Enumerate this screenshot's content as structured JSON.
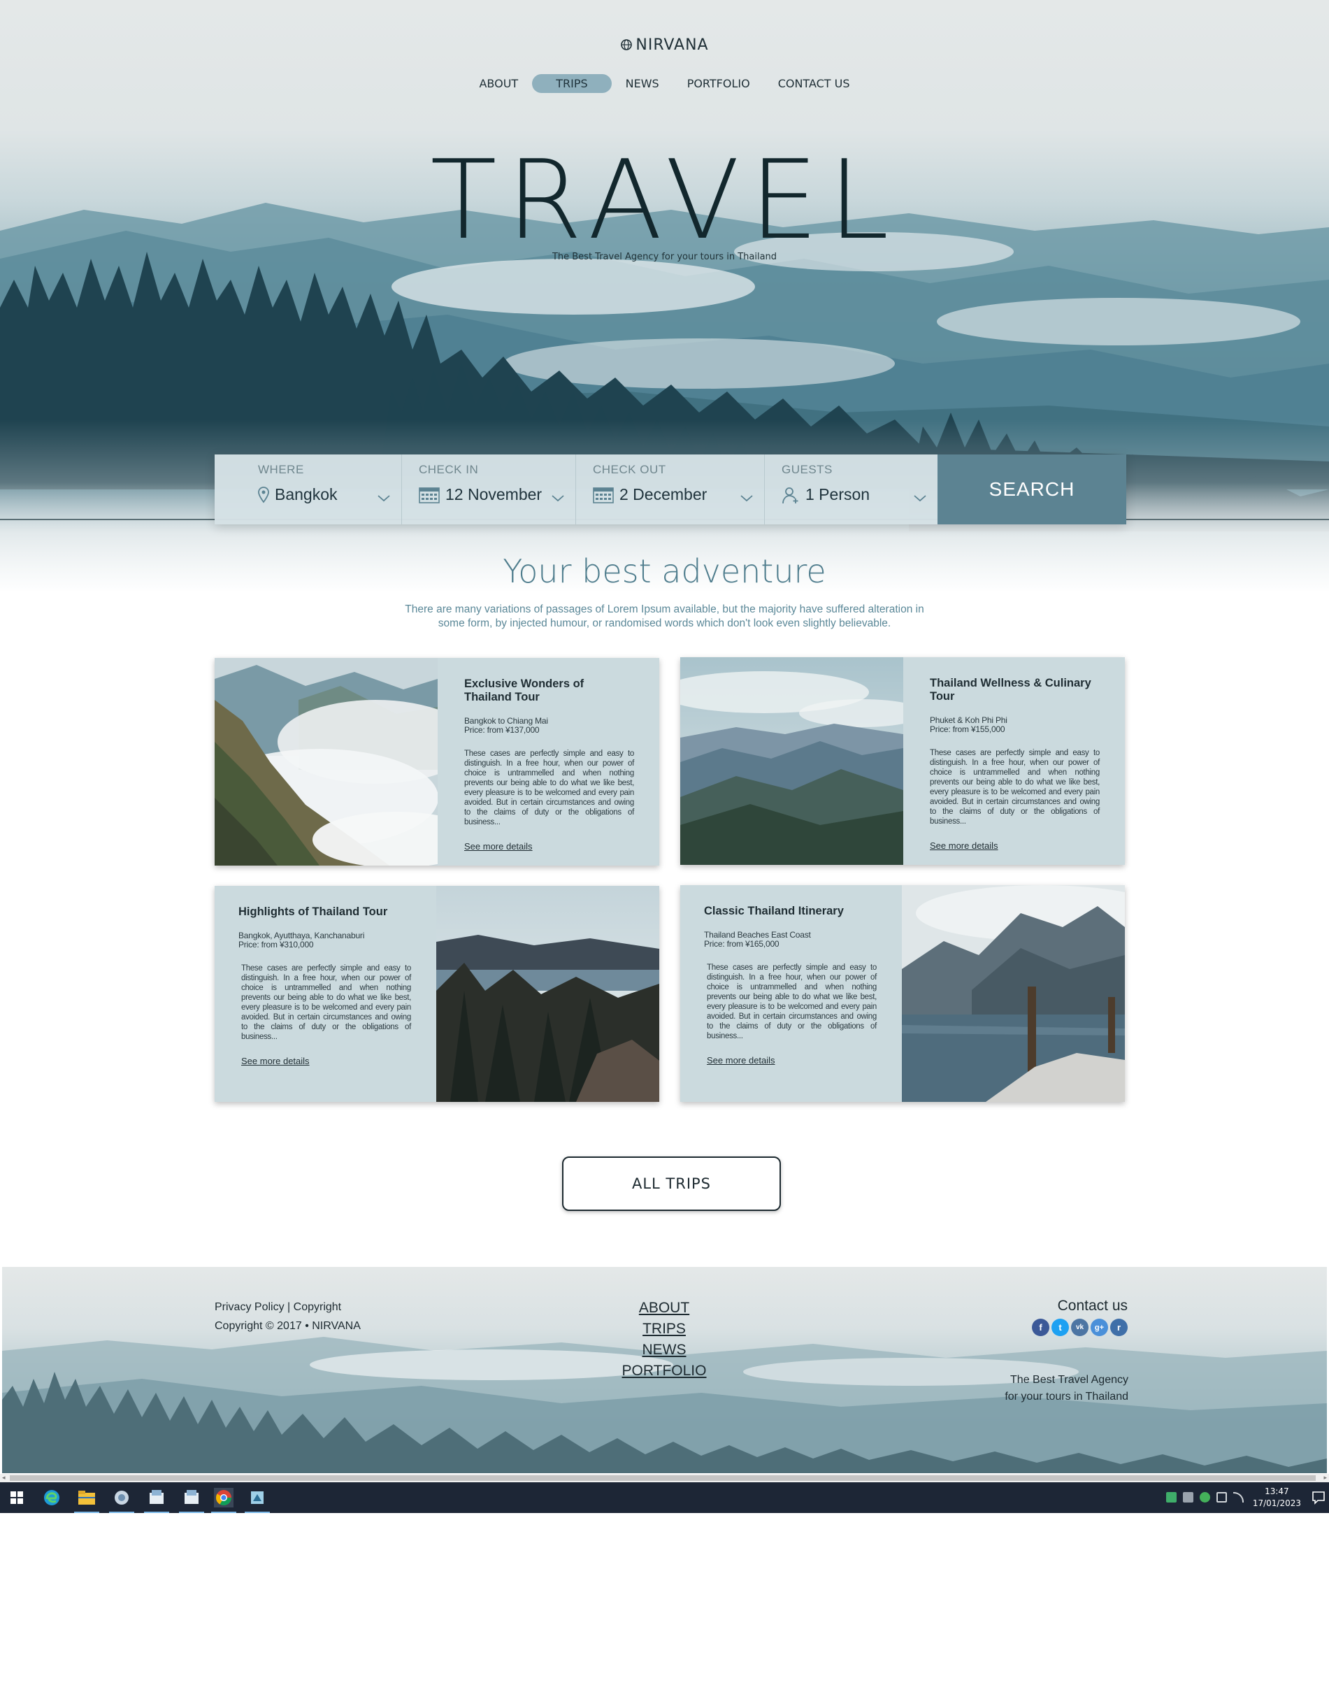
{
  "brand": {
    "name": "NIRVANA"
  },
  "nav": {
    "items": [
      "ABOUT",
      "TRIPS",
      "NEWS",
      "PORTFOLIO",
      "CONTACT US"
    ],
    "active": "TRIPS"
  },
  "hero": {
    "title": "TRAVEL",
    "subtitle": "The Best Travel Agency for your tours in Thailand"
  },
  "search": {
    "where": {
      "label": "WHERE",
      "value": "Bangkok",
      "icon": "map-pin-icon"
    },
    "check_in": {
      "label": "CHECK IN",
      "value": "12 November",
      "icon": "calendar-icon"
    },
    "check_out": {
      "label": "CHECK OUT",
      "value": "2 December",
      "icon": "calendar-icon"
    },
    "guests": {
      "label": "GUESTS",
      "value": "1 Person",
      "icon": "person-icon"
    },
    "button": "SEARCH"
  },
  "adventure": {
    "title": "Your best adventure",
    "description": "There are many variations of passages of Lorem Ipsum available, but the majority have suffered alteration in some form, by injected humour, or randomised words which don't look even slightly believable."
  },
  "tours": [
    {
      "title": "Exclusive Wonders of Thailand Tour",
      "route": "Bangkok to Chiang Mai",
      "price": "Price:  from ¥137,000",
      "description": "These cases are perfectly simple and easy to distinguish. In a free hour, when our power of choice is untrammelled and when nothing prevents our being able to do what we like best, every pleasure is to be welcomed and every pain avoided. But in certain circumstances and owing to the claims of duty or the obligations of business...",
      "link": "See more details"
    },
    {
      "title": "Thailand Wellness & Culinary Tour",
      "route": "Phuket & Koh Phi Phi",
      "price": "Price:  from ¥155,000",
      "description": "These cases are perfectly simple and easy to distinguish. In a free hour, when our power of choice is untrammelled and when nothing prevents our being able to do what we like best, every pleasure is to be welcomed and every pain avoided. But in certain circumstances and owing to the claims of duty or the obligations of business...",
      "link": "See more details"
    },
    {
      "title": "Highlights of Thailand Tour",
      "route": "Bangkok, Ayutthaya, Kanchanaburi",
      "price": "Price:  from ¥310,000",
      "description": "These cases are perfectly simple and easy to distinguish. In a free hour, when our power of choice is untrammelled and when nothing prevents our being able to do what we like best, every pleasure is to be welcomed and every pain avoided. But in certain circumstances and owing to the claims of duty or the obligations of business...",
      "link": "See more details"
    },
    {
      "title": "Classic Thailand Itinerary",
      "route": "Thailand Beaches East Coast",
      "price": "Price:  from ¥165,000",
      "description": "These cases are perfectly simple and easy to distinguish. In a free hour, when our power of choice is untrammelled and when nothing prevents our being able to do what we like best, every pleasure is to be welcomed and every pain avoided. But in certain circumstances and owing to the claims of duty or the obligations of business...",
      "link": "See more details"
    }
  ],
  "all_trips_button": "ALL TRIPS",
  "footer": {
    "privacy": "Privacy Policy",
    "separator": "|",
    "copyright_link": "Copyright",
    "copyright": "Copyright © 2017 • NIRVANA",
    "nav": [
      "ABOUT",
      "TRIPS",
      "NEWS",
      "PORTFOLIO"
    ],
    "contact_title": "Contact us",
    "socials": [
      {
        "icon": "facebook-icon",
        "glyph": "f",
        "color": "#3b5998"
      },
      {
        "icon": "twitter-icon",
        "glyph": "t",
        "color": "#1da1f2"
      },
      {
        "icon": "vk-icon",
        "glyph": "vk",
        "color": "#4c75a3"
      },
      {
        "icon": "google-plus-icon",
        "glyph": "g+",
        "color": "#4a90d9"
      },
      {
        "icon": "rss-icon",
        "glyph": "r",
        "color": "#3f6fa8"
      }
    ],
    "tagline_line1": "The Best Travel Agency",
    "tagline_line2": "for your tours in Thailand"
  },
  "taskbar": {
    "icons": [
      "windows-start-icon",
      "edge-browser-icon",
      "file-explorer-icon",
      "app-icon",
      "app-icon",
      "app-icon",
      "chrome-icon",
      "app-icon"
    ],
    "time": "13:47",
    "date": "17/01/2023"
  },
  "colors": {
    "accent": "#5c8392",
    "card_bg": "#cbdade",
    "title_teal": "#4f7d8d",
    "taskbar": "#1d2636"
  }
}
